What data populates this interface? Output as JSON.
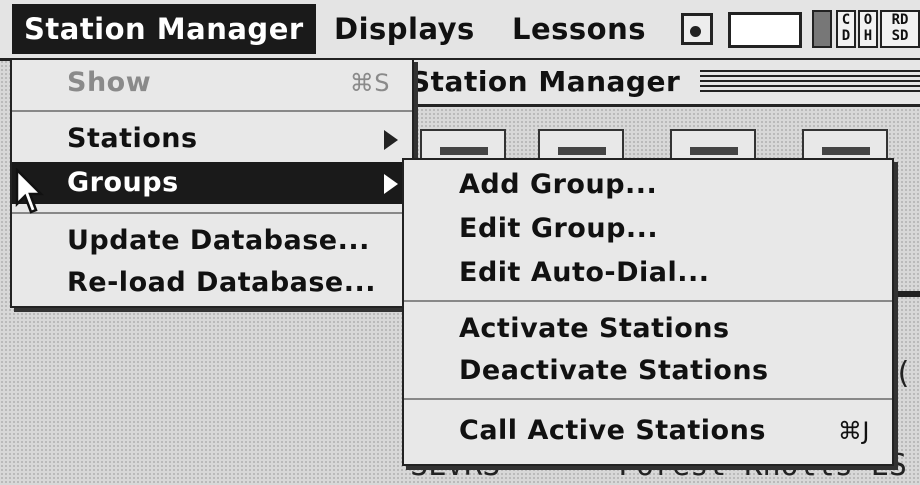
{
  "menubar": {
    "menus": [
      "Station Manager",
      "Displays",
      "Lessons"
    ],
    "status_chips": [
      {
        "top": "C",
        "bottom": "D"
      },
      {
        "top": "O",
        "bottom": "H"
      },
      {
        "top": "RD",
        "bottom": "SD"
      }
    ]
  },
  "window": {
    "title": "Station Manager",
    "visible_text_1": "d(",
    "visible_text_2": "SLVRS",
    "visible_text_3": "Forest Knolls ES"
  },
  "station_menu": {
    "items": [
      {
        "label": "Show",
        "shortcut": "⌘S",
        "enabled": false
      },
      {
        "label": "Stations",
        "submenu": true
      },
      {
        "label": "Groups",
        "submenu": true,
        "highlighted": true
      },
      {
        "label": "Update Database..."
      },
      {
        "label": "Re-load Database..."
      }
    ]
  },
  "groups_submenu": {
    "items": [
      {
        "label": "Add Group..."
      },
      {
        "label": "Edit Group..."
      },
      {
        "label": "Edit Auto-Dial..."
      },
      {
        "label": "Activate Stations"
      },
      {
        "label": "Deactivate Stations"
      },
      {
        "label": "Call Active Stations",
        "shortcut": "⌘J"
      }
    ]
  },
  "icons": [
    "apple-like-app-icon",
    "arrow-cursor-icon",
    "submenu-arrow-icon"
  ]
}
